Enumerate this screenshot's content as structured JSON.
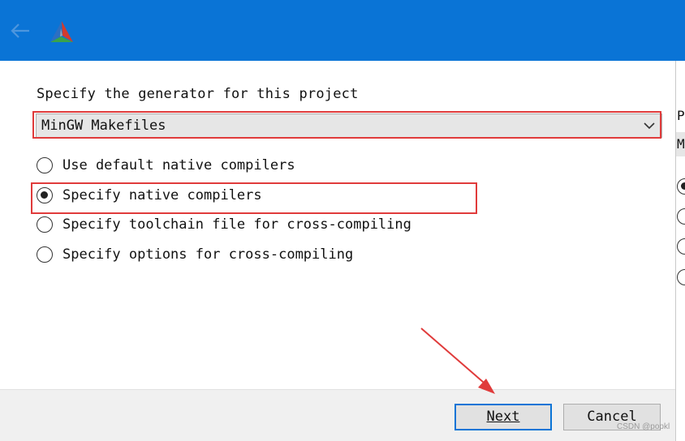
{
  "window": {
    "prompt": "Specify the generator for this project",
    "generator": {
      "value": "MinGW Makefiles"
    },
    "options": [
      {
        "label": "Use default native compilers",
        "checked": false
      },
      {
        "label": "Specify native compilers",
        "checked": true
      },
      {
        "label": "Specify toolchain file for cross-compiling",
        "checked": false
      },
      {
        "label": "Specify options for cross-compiling",
        "checked": false
      }
    ],
    "buttons": {
      "next": "Next",
      "cancel": "Cancel"
    }
  },
  "background_window": {
    "line1": "P",
    "line2": "Mi"
  },
  "icons": {
    "back": "back-arrow-icon",
    "logo": "cmake-logo-icon",
    "dropdown": "chevron-down-icon"
  },
  "colors": {
    "titlebar": "#0a74d6",
    "highlight": "#e03b3b",
    "primary_border": "#0a74d6"
  },
  "watermark": "CSDN @popkl"
}
